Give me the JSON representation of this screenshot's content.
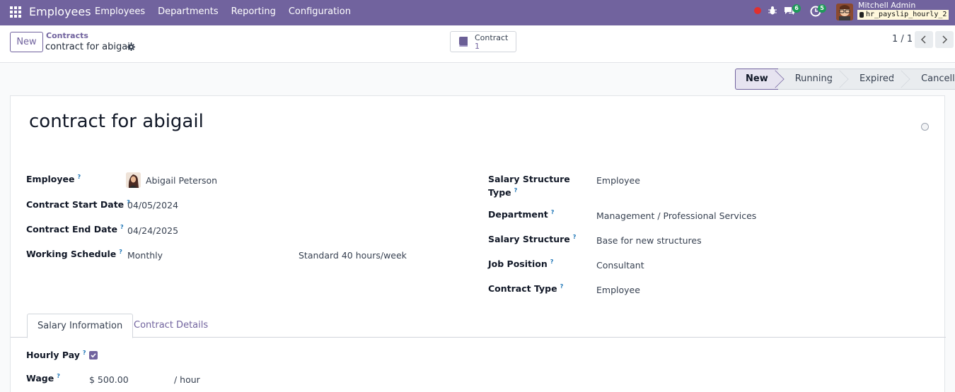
{
  "navbar": {
    "brand": "Employees",
    "menu": [
      "Employees",
      "Departments",
      "Reporting",
      "Configuration"
    ],
    "messages_count": "6",
    "activities_count": "5",
    "user_name": "Mitchell Admin",
    "database": "hr_payslip_hourly_2"
  },
  "control": {
    "new_label": "New",
    "breadcrumb_parent": "Contracts",
    "breadcrumb_current": "contract for abigail",
    "smart_button_label": "Contract",
    "smart_button_value": "1",
    "pager": "1 / 1"
  },
  "statusbar": [
    "New",
    "Running",
    "Expired",
    "Cancelled"
  ],
  "form": {
    "title": "contract for abigail",
    "left_fields": {
      "employee_label": "Employee",
      "employee_value": "Abigail Peterson",
      "start_label": "Contract Start Date",
      "start_value": "04/05/2024",
      "end_label": "Contract End Date",
      "end_value": "04/24/2025",
      "schedule_label": "Working Schedule",
      "schedule_value": "Monthly",
      "schedule_hours": "Standard 40 hours/week"
    },
    "right_fields": {
      "sst_label_1": "Salary Structure",
      "sst_label_2": "Type",
      "sst_value": "Employee",
      "dept_label": "Department",
      "dept_value": "Management / Professional Services",
      "ss_label": "Salary Structure",
      "ss_value": "Base for new structures",
      "job_label": "Job Position",
      "job_value": "Consultant",
      "ctype_label": "Contract Type",
      "ctype_value": "Employee"
    },
    "tabs": [
      "Salary Information",
      "Contract Details"
    ],
    "salary": {
      "hourly_label": "Hourly Pay",
      "hourly_checked": true,
      "wage_label": "Wage",
      "wage_value": "$ 500.00",
      "wage_unit": "/ hour"
    },
    "help_mark": "?"
  },
  "colors": {
    "brand": "#71639e",
    "help": "#1a73b5",
    "badge": "#1f9b5a"
  }
}
